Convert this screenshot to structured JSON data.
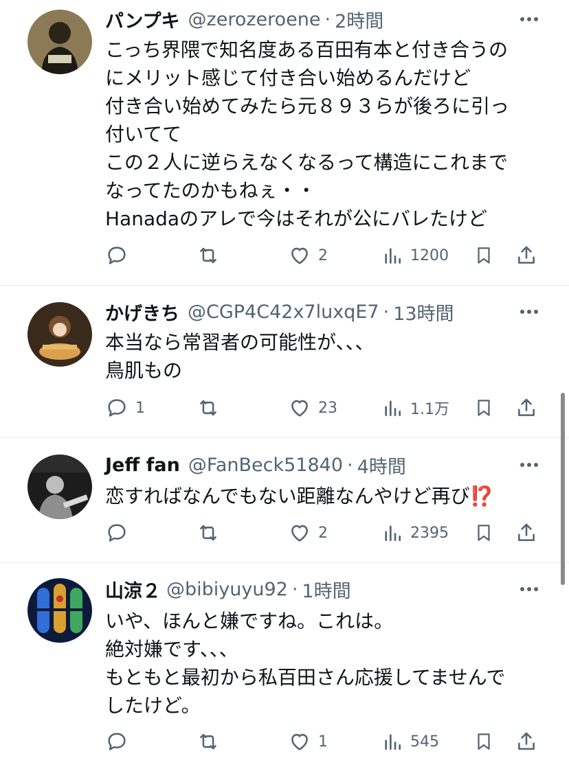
{
  "replies": [
    {
      "name": "パンプキ",
      "handle": "@zerozeroene",
      "time": "2時間",
      "lines": [
        "こっち界隈で知名度ある百田有本と付き合うの",
        "にメリット感じて付き合い始めるんだけど",
        "付き合い始めてみたら元８９３らが後ろに引っ",
        "付いてて",
        "この２人に逆らえなくなるって構造にこれまで",
        "なってたのかもねぇ・・",
        "Hanadaのアレで今はそれが公にバレたけど"
      ],
      "replies_count": "",
      "retweets_count": "",
      "likes_count": "2",
      "views_count": "1200"
    },
    {
      "name": "かげきち",
      "handle": "@CGP4C42x7luxqE7",
      "time": "13時間",
      "lines": [
        "本当なら常習者の可能性が、、、",
        "鳥肌もの"
      ],
      "replies_count": "1",
      "retweets_count": "",
      "likes_count": "23",
      "views_count": "1.1万"
    },
    {
      "name": "Jeff fan",
      "handle": "@FanBeck51840",
      "time": "4時間",
      "lines": [
        "恋すればなんでもない距離なんやけど再び⁉️"
      ],
      "replies_count": "",
      "retweets_count": "",
      "likes_count": "2",
      "views_count": "2395"
    },
    {
      "name": "山涼２",
      "handle": "@bibiyuyu92",
      "time": "1時間",
      "lines": [
        "いや、ほんと嫌ですね。これは。",
        "絶対嫌です、、、",
        "もともと最初から私百田さん応援してませんで",
        "したけど。"
      ],
      "replies_count": "",
      "retweets_count": "",
      "likes_count": "1",
      "views_count": "545"
    }
  ],
  "separator": "·",
  "icons": [
    "more-icon",
    "reply-icon",
    "retweet-icon",
    "like-icon",
    "views-icon",
    "bookmark-icon",
    "share-icon"
  ],
  "colors": {
    "text": "#0f1419",
    "muted": "#536471",
    "divider": "#e6e9ec",
    "emoji": "#e0245e"
  }
}
